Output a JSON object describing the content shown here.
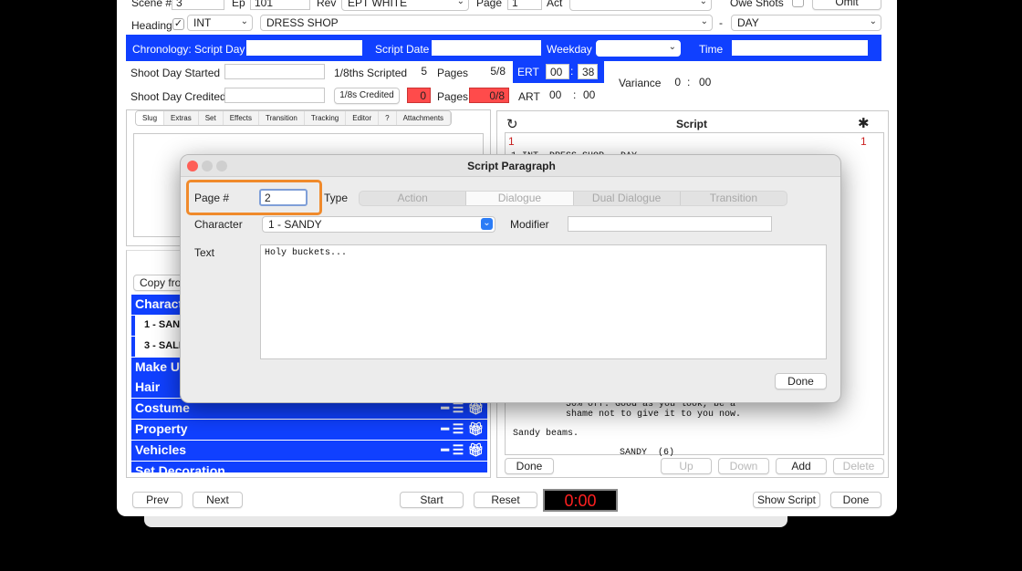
{
  "top": {
    "scene_label": "Scene #",
    "scene_value": "3",
    "ep_label": "Ep",
    "ep_value": "101",
    "rev_label": "Rev",
    "rev_value": "EPT WHITE",
    "page_label": "Page",
    "page_value": "1",
    "act_label": "Act",
    "act_value": "",
    "owe_shots_label": "Owe Shots",
    "omit_label": "Omit"
  },
  "heading": {
    "label": "Heading",
    "checked": "✓",
    "int_ext": "INT",
    "location": "DRESS SHOP",
    "dash": "-",
    "time_of_day": "DAY"
  },
  "chronology": {
    "label": "Chronology: Script Day",
    "script_day": "",
    "script_date_label": "Script Date",
    "script_date": "",
    "weekday_label": "Weekday",
    "weekday": "",
    "time_label": "Time",
    "time": ""
  },
  "shoot": {
    "started_label": "Shoot Day Started",
    "started": "",
    "eighths_scripted_label": "1/8ths Scripted",
    "eighths_scripted": "5",
    "pages_label": "Pages",
    "pages_scripted": "5/8",
    "ert_label": "ERT",
    "ert_min": "00",
    "ert_sec": "38",
    "credited_label": "Shoot Day Credited",
    "credited": "",
    "eighths_credited_button": "1/8s Credited",
    "eighths_credited": "0",
    "pages_credited_label": "Pages",
    "pages_credited": "0/8",
    "art_label": "ART",
    "art_min": "00",
    "art_sec": "00",
    "variance_label": "Variance",
    "variance_min": "0",
    "variance_sec": "00",
    "colon": ":"
  },
  "left_tabs": [
    "Slug",
    "Extras",
    "Set",
    "Effects",
    "Transition",
    "Tracking",
    "Editor",
    "?",
    "Attachments"
  ],
  "breakdown": {
    "copy_from_label": "Copy from",
    "character_header": "Characters",
    "characters": [
      "1 - SANDY",
      "3 - SALES"
    ],
    "categories": [
      "Make Up",
      "Hair",
      "Costume",
      "Property",
      "Vehicles",
      "Set Decoration"
    ]
  },
  "script_panel": {
    "title": "Script",
    "page_left": "1",
    "page_right": "1",
    "line_top": "1 INT. DRESS SHOP - DAY",
    "dialogue_lines": [
      "50% off. Good as you look, be a",
      "shame not to give it to you now."
    ],
    "action_line": "Sandy beams.",
    "next_character": "SANDY  (6)",
    "done": "Done",
    "up": "Up",
    "down": "Down",
    "add": "Add",
    "delete": "Delete"
  },
  "bottom": {
    "prev": "Prev",
    "next": "Next",
    "start": "Start",
    "reset": "Reset",
    "timer": "0:00",
    "show_script": "Show Script",
    "done": "Done"
  },
  "dialog": {
    "title": "Script Paragraph",
    "page_label": "Page #",
    "page_value": "2",
    "type_label": "Type",
    "types": [
      "Action",
      "Dialogue",
      "Dual Dialogue",
      "Transition"
    ],
    "selected_type": "Dialogue",
    "character_label": "Character",
    "character_value": "1 - SANDY",
    "modifier_label": "Modifier",
    "modifier_value": "",
    "text_label": "Text",
    "text_value": "Holy buckets...",
    "done": "Done"
  }
}
